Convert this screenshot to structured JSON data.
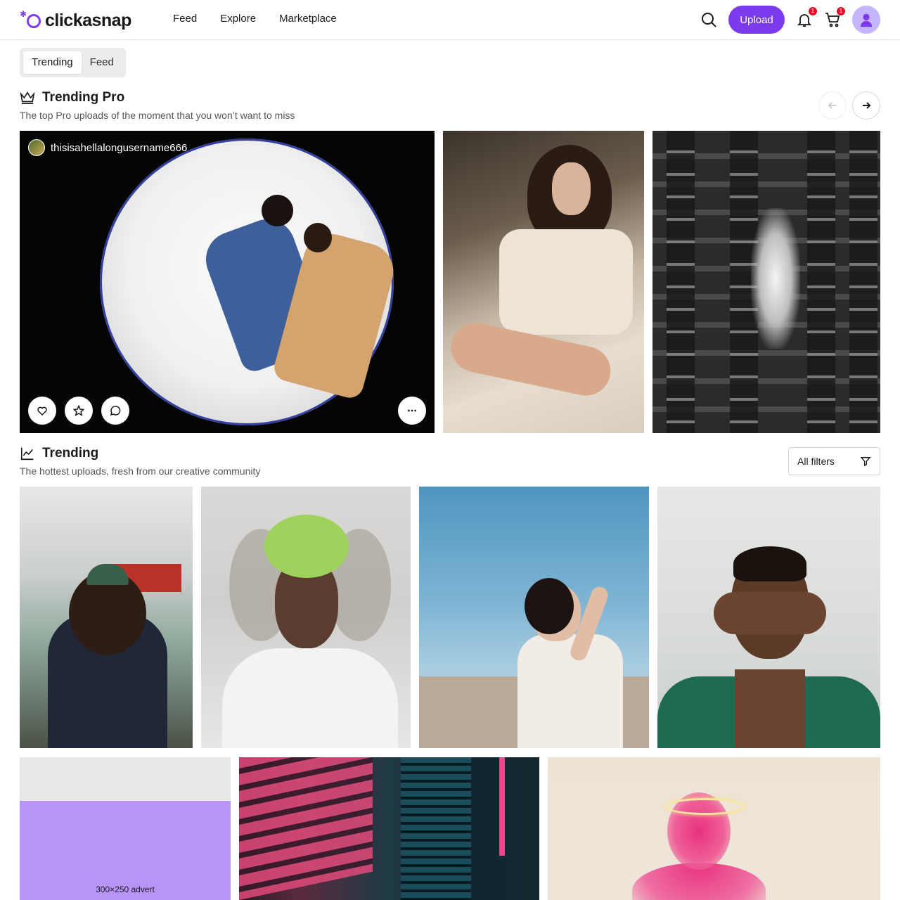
{
  "header": {
    "logo_text": "clickasnap",
    "nav": [
      "Feed",
      "Explore",
      "Marketplace"
    ],
    "upload_label": "Upload",
    "notifications_count": "1",
    "cart_count": "1",
    "accent_color": "#7c3aed"
  },
  "view_toggle": {
    "options": [
      "Trending",
      "Feed"
    ],
    "selected": "Trending"
  },
  "trending_pro": {
    "title": "Trending Pro",
    "subtitle": "The top Pro uploads of the moment that you won’t want to miss",
    "icon": "crown-icon",
    "featured_username": "thisisahellalongusername666",
    "actions": [
      "heart-icon",
      "star-icon",
      "comment-icon",
      "more-icon"
    ]
  },
  "trending": {
    "title": "Trending",
    "subtitle": "The hottest uploads, fresh from our creative community",
    "icon": "chart-line-icon",
    "filters_label": "All filters"
  },
  "advert": {
    "label": "300×250 advert",
    "color": "#b794f6"
  }
}
